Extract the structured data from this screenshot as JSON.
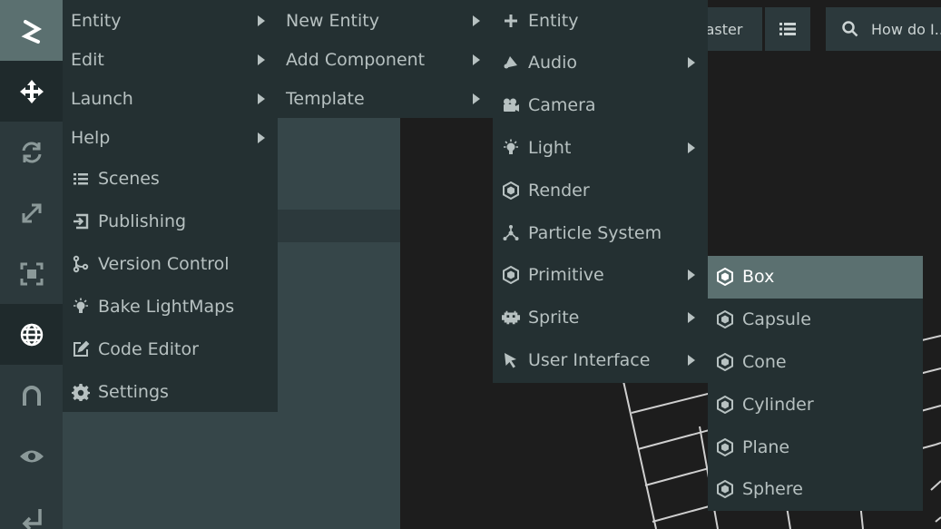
{
  "topbar": {
    "branch_label": "master",
    "search_text": "How do I..."
  },
  "menus": {
    "main": [
      {
        "label": "Entity",
        "submenu": true
      },
      {
        "label": "Edit",
        "submenu": true
      },
      {
        "label": "Launch",
        "submenu": true
      },
      {
        "label": "Help",
        "submenu": true
      },
      {
        "label": "Scenes",
        "icon": "list-icon"
      },
      {
        "label": "Publishing",
        "icon": "publish-icon"
      },
      {
        "label": "Version Control",
        "icon": "branch-icon"
      },
      {
        "label": "Bake LightMaps",
        "icon": "bulb-icon"
      },
      {
        "label": "Code Editor",
        "icon": "edit-icon"
      },
      {
        "label": "Settings",
        "icon": "gear-icon"
      }
    ],
    "new": [
      {
        "label": "New Entity",
        "submenu": true
      },
      {
        "label": "Add Component",
        "submenu": true
      },
      {
        "label": "Template",
        "submenu": true
      }
    ],
    "entity": [
      {
        "label": "Entity",
        "icon": "plus-icon"
      },
      {
        "label": "Audio",
        "icon": "speaker-icon",
        "submenu": true
      },
      {
        "label": "Camera",
        "icon": "camera-icon"
      },
      {
        "label": "Light",
        "icon": "bulb-icon",
        "submenu": true
      },
      {
        "label": "Render",
        "icon": "hexagon-icon"
      },
      {
        "label": "Particle System",
        "icon": "particles-icon"
      },
      {
        "label": "Primitive",
        "icon": "hexagon-icon",
        "submenu": true
      },
      {
        "label": "Sprite",
        "icon": "sprite-icon",
        "submenu": true
      },
      {
        "label": "User Interface",
        "icon": "cursor-icon",
        "submenu": true
      }
    ],
    "primitive": [
      {
        "label": "Box",
        "icon": "hexagon-icon",
        "highlighted": true
      },
      {
        "label": "Capsule",
        "icon": "hexagon-icon"
      },
      {
        "label": "Cone",
        "icon": "hexagon-icon"
      },
      {
        "label": "Cylinder",
        "icon": "hexagon-icon"
      },
      {
        "label": "Plane",
        "icon": "hexagon-icon"
      },
      {
        "label": "Sphere",
        "icon": "hexagon-icon"
      }
    ]
  },
  "toolbar": [
    {
      "icon": "logo-icon",
      "state": "logo"
    },
    {
      "icon": "move-icon",
      "state": "active"
    },
    {
      "icon": "rotate-icon"
    },
    {
      "icon": "scale-icon"
    },
    {
      "icon": "resize-icon"
    },
    {
      "icon": "world-icon",
      "state": "active"
    },
    {
      "icon": "magnet-icon"
    },
    {
      "icon": "eye-icon"
    },
    {
      "icon": "return-icon"
    }
  ],
  "colors": {
    "accent": "#5b7070",
    "menu_bg": "#243032",
    "toolbar_bg": "#2c393c",
    "text": "#b7c1c1"
  }
}
